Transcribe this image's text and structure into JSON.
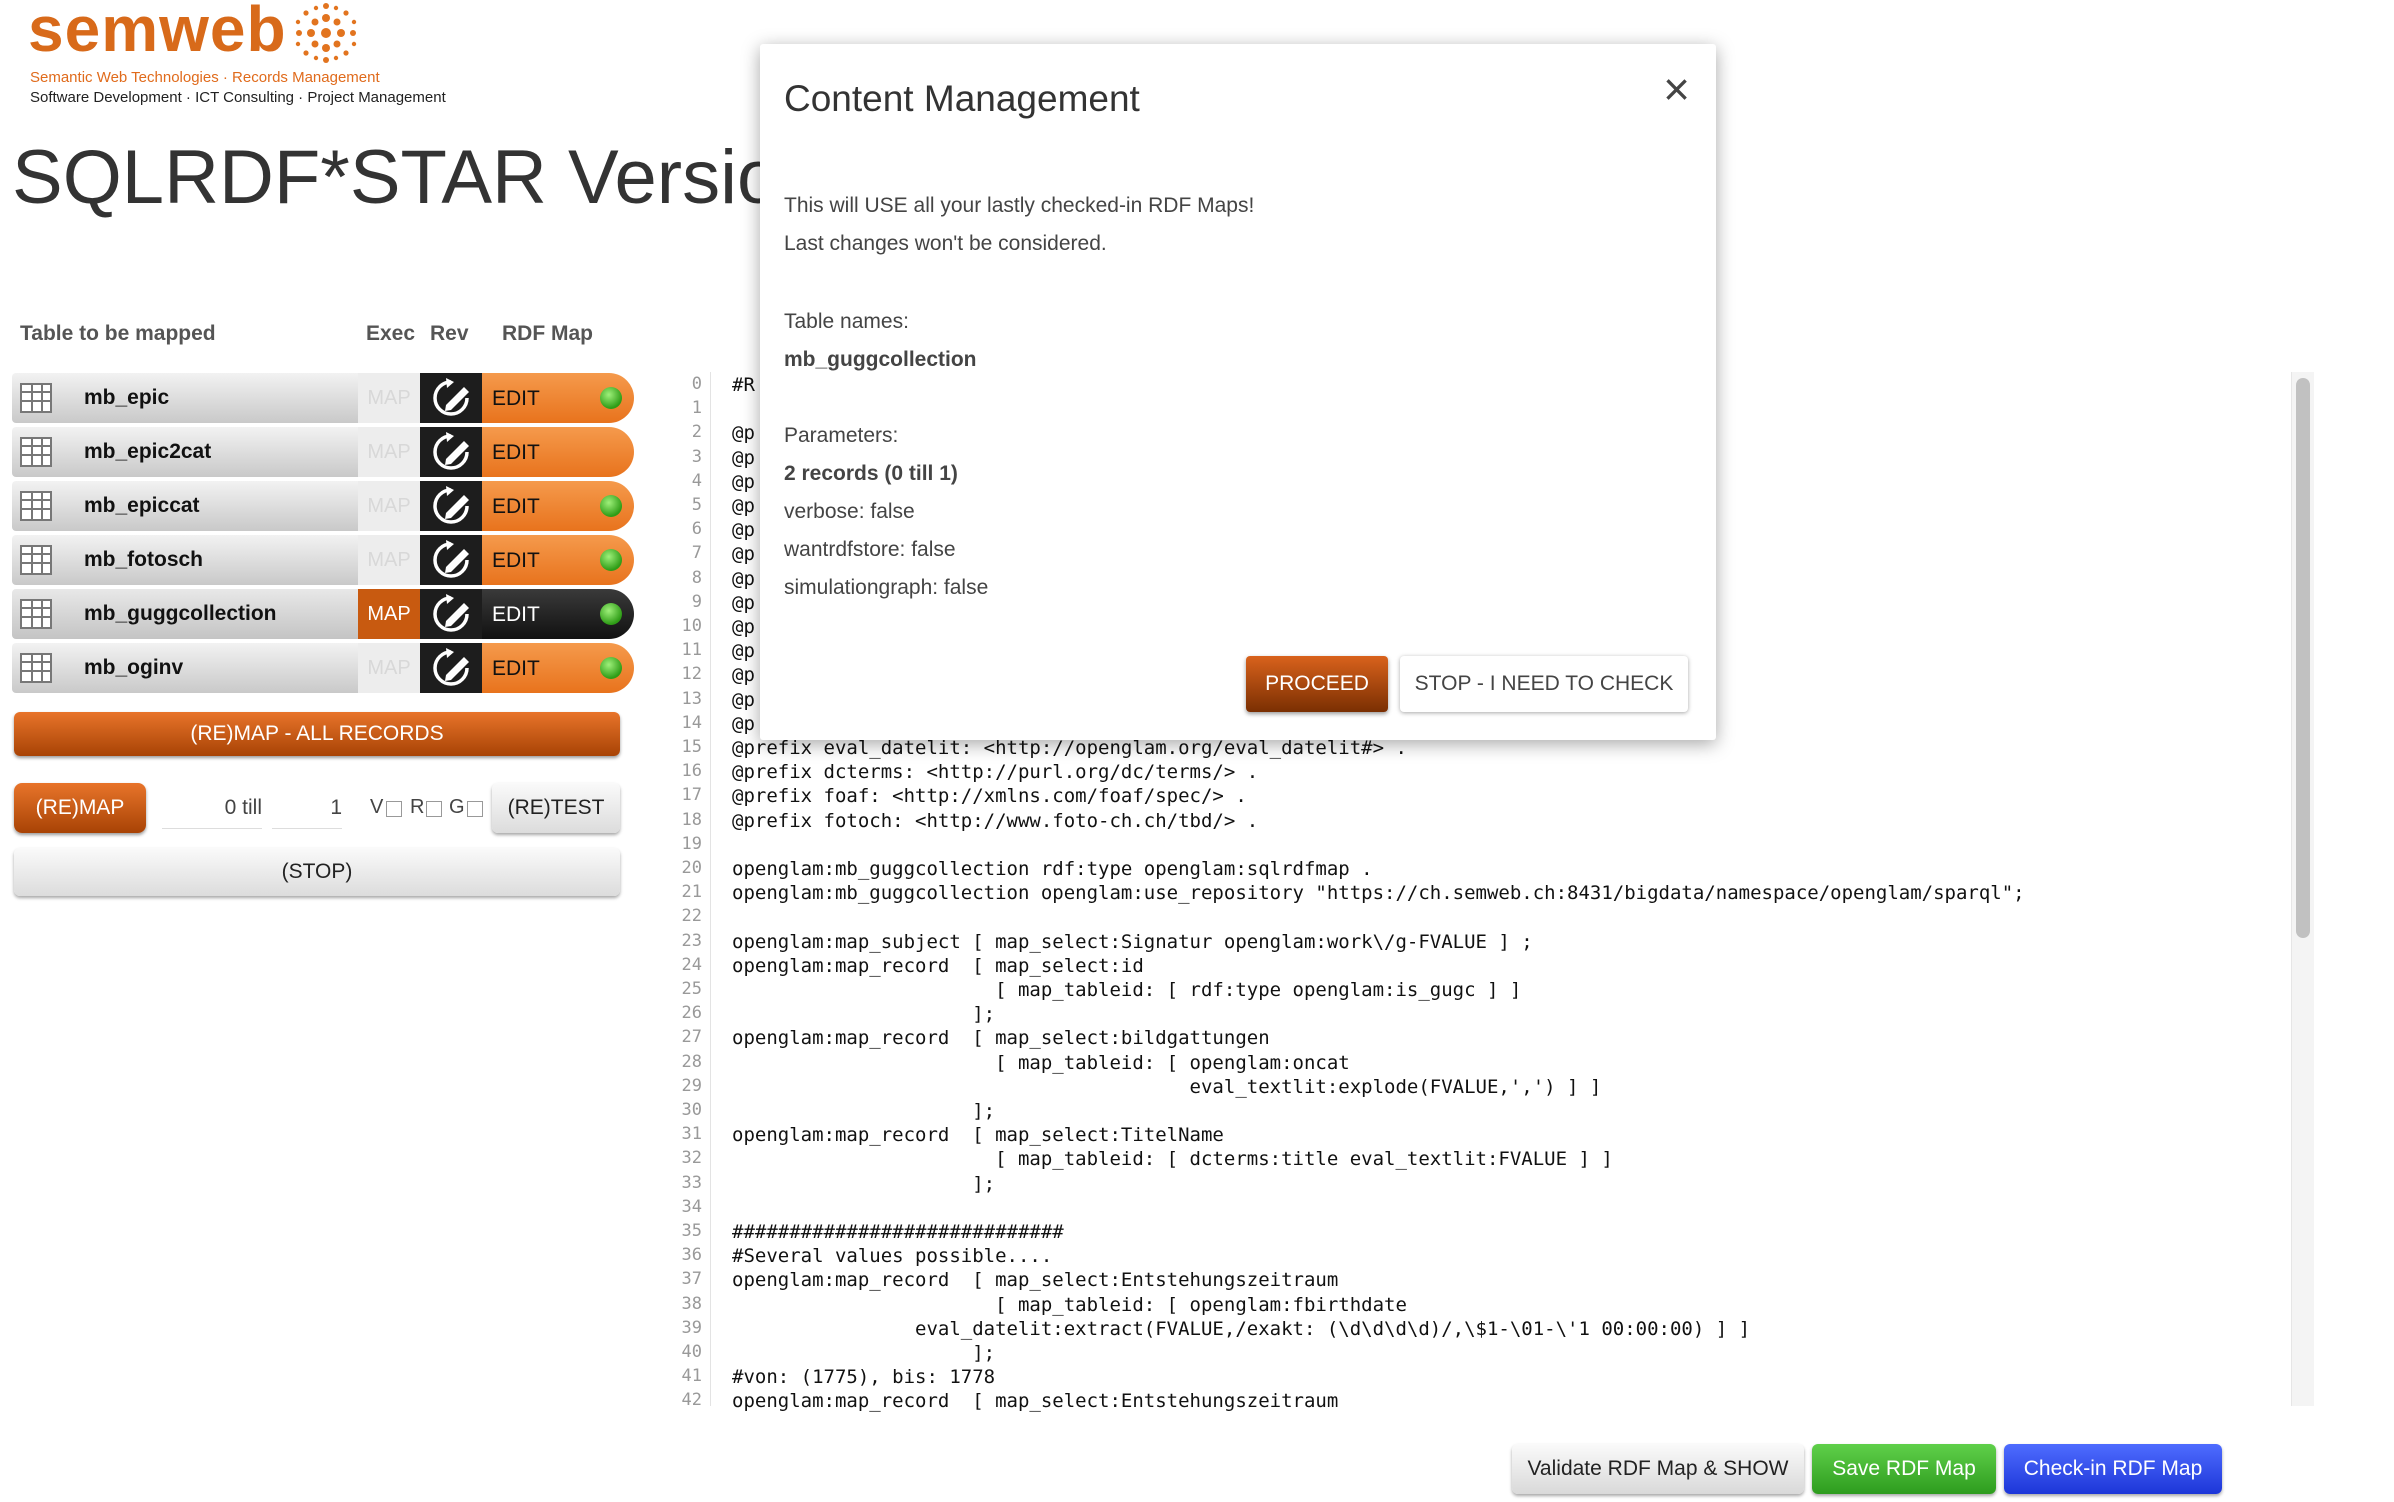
{
  "brand": {
    "name": "semweb",
    "tagline1": "Semantic Web Technologies · Records Management",
    "tagline2": "Software Development · ICT Consulting · Project Management",
    "accent": "#d86a1a"
  },
  "page": {
    "title": "SQLRDF*STAR Version"
  },
  "table": {
    "headers": {
      "name": "Table to be mapped",
      "exec": "Exec",
      "rev": "Rev",
      "rdfmap": "RDF Map"
    },
    "rows": [
      {
        "name": "mb_epic",
        "map": "MAP",
        "edit": "EDIT",
        "status": "green"
      },
      {
        "name": "mb_epic2cat",
        "map": "MAP",
        "edit": "EDIT",
        "status": "none"
      },
      {
        "name": "mb_epiccat",
        "map": "MAP",
        "edit": "EDIT",
        "status": "green"
      },
      {
        "name": "mb_fotosch",
        "map": "MAP",
        "edit": "EDIT",
        "status": "green"
      },
      {
        "name": "mb_guggcollection",
        "map": "MAP",
        "edit": "EDIT",
        "status": "green",
        "active": true
      },
      {
        "name": "mb_oginv",
        "map": "MAP",
        "edit": "EDIT",
        "status": "green"
      }
    ]
  },
  "controls": {
    "remap_all": "(RE)MAP - ALL RECORDS",
    "remap": "(RE)MAP",
    "range_from": "0 till",
    "range_to": "1",
    "cb_v": "V",
    "cb_r": "R",
    "cb_g": "G",
    "retest": "(RE)TEST",
    "stop": "(STOP)"
  },
  "editor": {
    "lines": [
      "#R",
      "",
      "@p",
      "@p",
      "@p",
      "@p",
      "@p",
      "@p",
      "@p",
      "@p",
      "@p",
      "@p",
      "@p",
      "@p",
      "@p",
      "@prefix eval_datelit: <http://openglam.org/eval_datelit#> .",
      "@prefix dcterms: <http://purl.org/dc/terms/> .",
      "@prefix foaf: <http://xmlns.com/foaf/spec/> .",
      "@prefix fotoch: <http://www.foto-ch.ch/tbd/> .",
      "",
      "openglam:mb_guggcollection rdf:type openglam:sqlrdfmap .",
      "openglam:mb_guggcollection openglam:use_repository \"https://ch.semweb.ch:8431/bigdata/namespace/openglam/sparql\";",
      "",
      "openglam:map_subject [ map_select:Signatur openglam:work\\/g-FVALUE ] ;",
      "openglam:map_record  [ map_select:id",
      "                       [ map_tableid: [ rdf:type openglam:is_gugc ] ]",
      "                     ];",
      "openglam:map_record  [ map_select:bildgattungen",
      "                       [ map_tableid: [ openglam:oncat",
      "                                        eval_textlit:explode(FVALUE,',') ] ]",
      "                     ];",
      "openglam:map_record  [ map_select:TitelName",
      "                       [ map_tableid: [ dcterms:title eval_textlit:FVALUE ] ]",
      "                     ];",
      "",
      "#############################",
      "#Several values possible....",
      "openglam:map_record  [ map_select:Entstehungszeitraum",
      "                       [ map_tableid: [ openglam:fbirthdate",
      "                eval_datelit:extract(FVALUE,/exakt: (\\d\\d\\d\\d)/,\\$1-\\01-\\'1 00:00:00) ] ]",
      "                     ];",
      "#von: (1775), bis: 1778",
      "openglam:map_record  [ map_select:Entstehungszeitraum"
    ]
  },
  "footer": {
    "validate": "Validate RDF Map & SHOW",
    "save": "Save RDF Map",
    "checkin": "Check-in RDF Map"
  },
  "modal": {
    "title": "Content Management",
    "close": "×",
    "msg1": "This will USE all your lastly checked-in RDF Maps!",
    "msg2": "Last changes won't be considered.",
    "table_names_label": "Table names:",
    "table_names_value": "mb_guggcollection",
    "params_label": "Parameters:",
    "records": "2 records (0 till 1)",
    "verbose": "verbose: false",
    "wantrdfstore": "wantrdfstore: false",
    "simulationgraph": "simulationgraph: false",
    "proceed": "PROCEED",
    "stop_check": "STOP - I NEED TO CHECK"
  }
}
